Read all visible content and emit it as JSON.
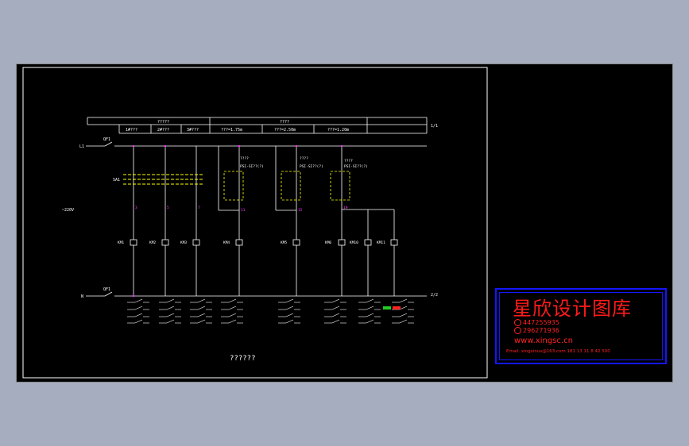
{
  "table": {
    "header_left": "?????",
    "header_right": "????",
    "cells": [
      "1#???",
      "2#???",
      "3#???",
      "???=1.75m",
      "???=2.50m",
      "???=1.20m"
    ],
    "sheet": "1/1"
  },
  "labels": {
    "l1": "L1",
    "n": "N",
    "voltage": "~220V",
    "qf1_top": "QF1",
    "qf1_bottom": "QF1",
    "sa1": "SA1",
    "sensor1": "PSI-SI??(?)",
    "sensor2": "PSI-SI??(?)",
    "sensor3": "PSI-SI??(?)",
    "dim1": "????",
    "dim2": "????",
    "dim3": "????",
    "pump_ref": "2/2",
    "coils": [
      "KM1",
      "KM2",
      "KM3",
      "KM4",
      "KM5",
      "KM6",
      "KM10",
      "KM11"
    ],
    "wire_nums": [
      "3",
      "5",
      "7",
      "11",
      "15",
      "19"
    ],
    "title": "??????"
  },
  "stamp": {
    "brand": "星欣设计图库",
    "qq1": "447255935",
    "qq2": "296271936",
    "website": "www.xingsc.cn",
    "email_line": "Email: xingxinus@163.com 181 13 11 8 42 500"
  },
  "colors": {
    "background": "#000000",
    "line": "#ffffff",
    "accent_yellow": "#ffff00",
    "accent_magenta": "#ff33ff",
    "stamp_red": "#ff1a1a",
    "stamp_blue": "#1515ff"
  }
}
